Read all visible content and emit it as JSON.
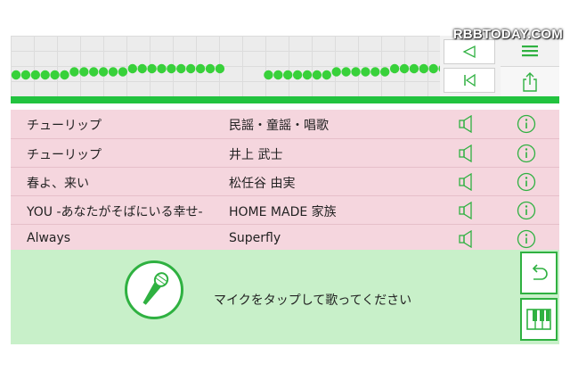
{
  "watermark": "RBBTODAY.COM",
  "colors": {
    "accent_green": "#22c33f",
    "note_green": "#38d13a",
    "song_list_bg": "#f5d6de",
    "mic_panel_bg": "#c8f0c9"
  },
  "pitch_display": {
    "note_levels": [
      2,
      2,
      2,
      2,
      2,
      2,
      3,
      3,
      3,
      3,
      3,
      3,
      4,
      4,
      4,
      4,
      4,
      4,
      4,
      4,
      4,
      4,
      null,
      null,
      null,
      null,
      2,
      2,
      2,
      2,
      2,
      2,
      2,
      3,
      3,
      3,
      3,
      3,
      3,
      4,
      4,
      4,
      4,
      4,
      4,
      4,
      4
    ]
  },
  "controls": {
    "menu_icon": "hamburger-icon",
    "back_icon": "triangle-left-icon",
    "rewind_icon": "skip-back-icon",
    "share_icon": "share-icon"
  },
  "songs": [
    {
      "title": "チューリップ",
      "artist": "民謡・童謡・唱歌"
    },
    {
      "title": "チューリップ",
      "artist": "井上 武士"
    },
    {
      "title": "春よ、来い",
      "artist": "松任谷 由実"
    },
    {
      "title": "YOU -あなたがそばにいる幸せ-",
      "artist": "HOME MADE 家族"
    },
    {
      "title": "Always",
      "artist": "Superfly"
    }
  ],
  "mic": {
    "icon": "microphone-icon",
    "prompt": "マイクをタップして歌ってください"
  },
  "side_buttons": {
    "undo_icon": "undo-icon",
    "keyboard_icon": "piano-keys-icon"
  }
}
